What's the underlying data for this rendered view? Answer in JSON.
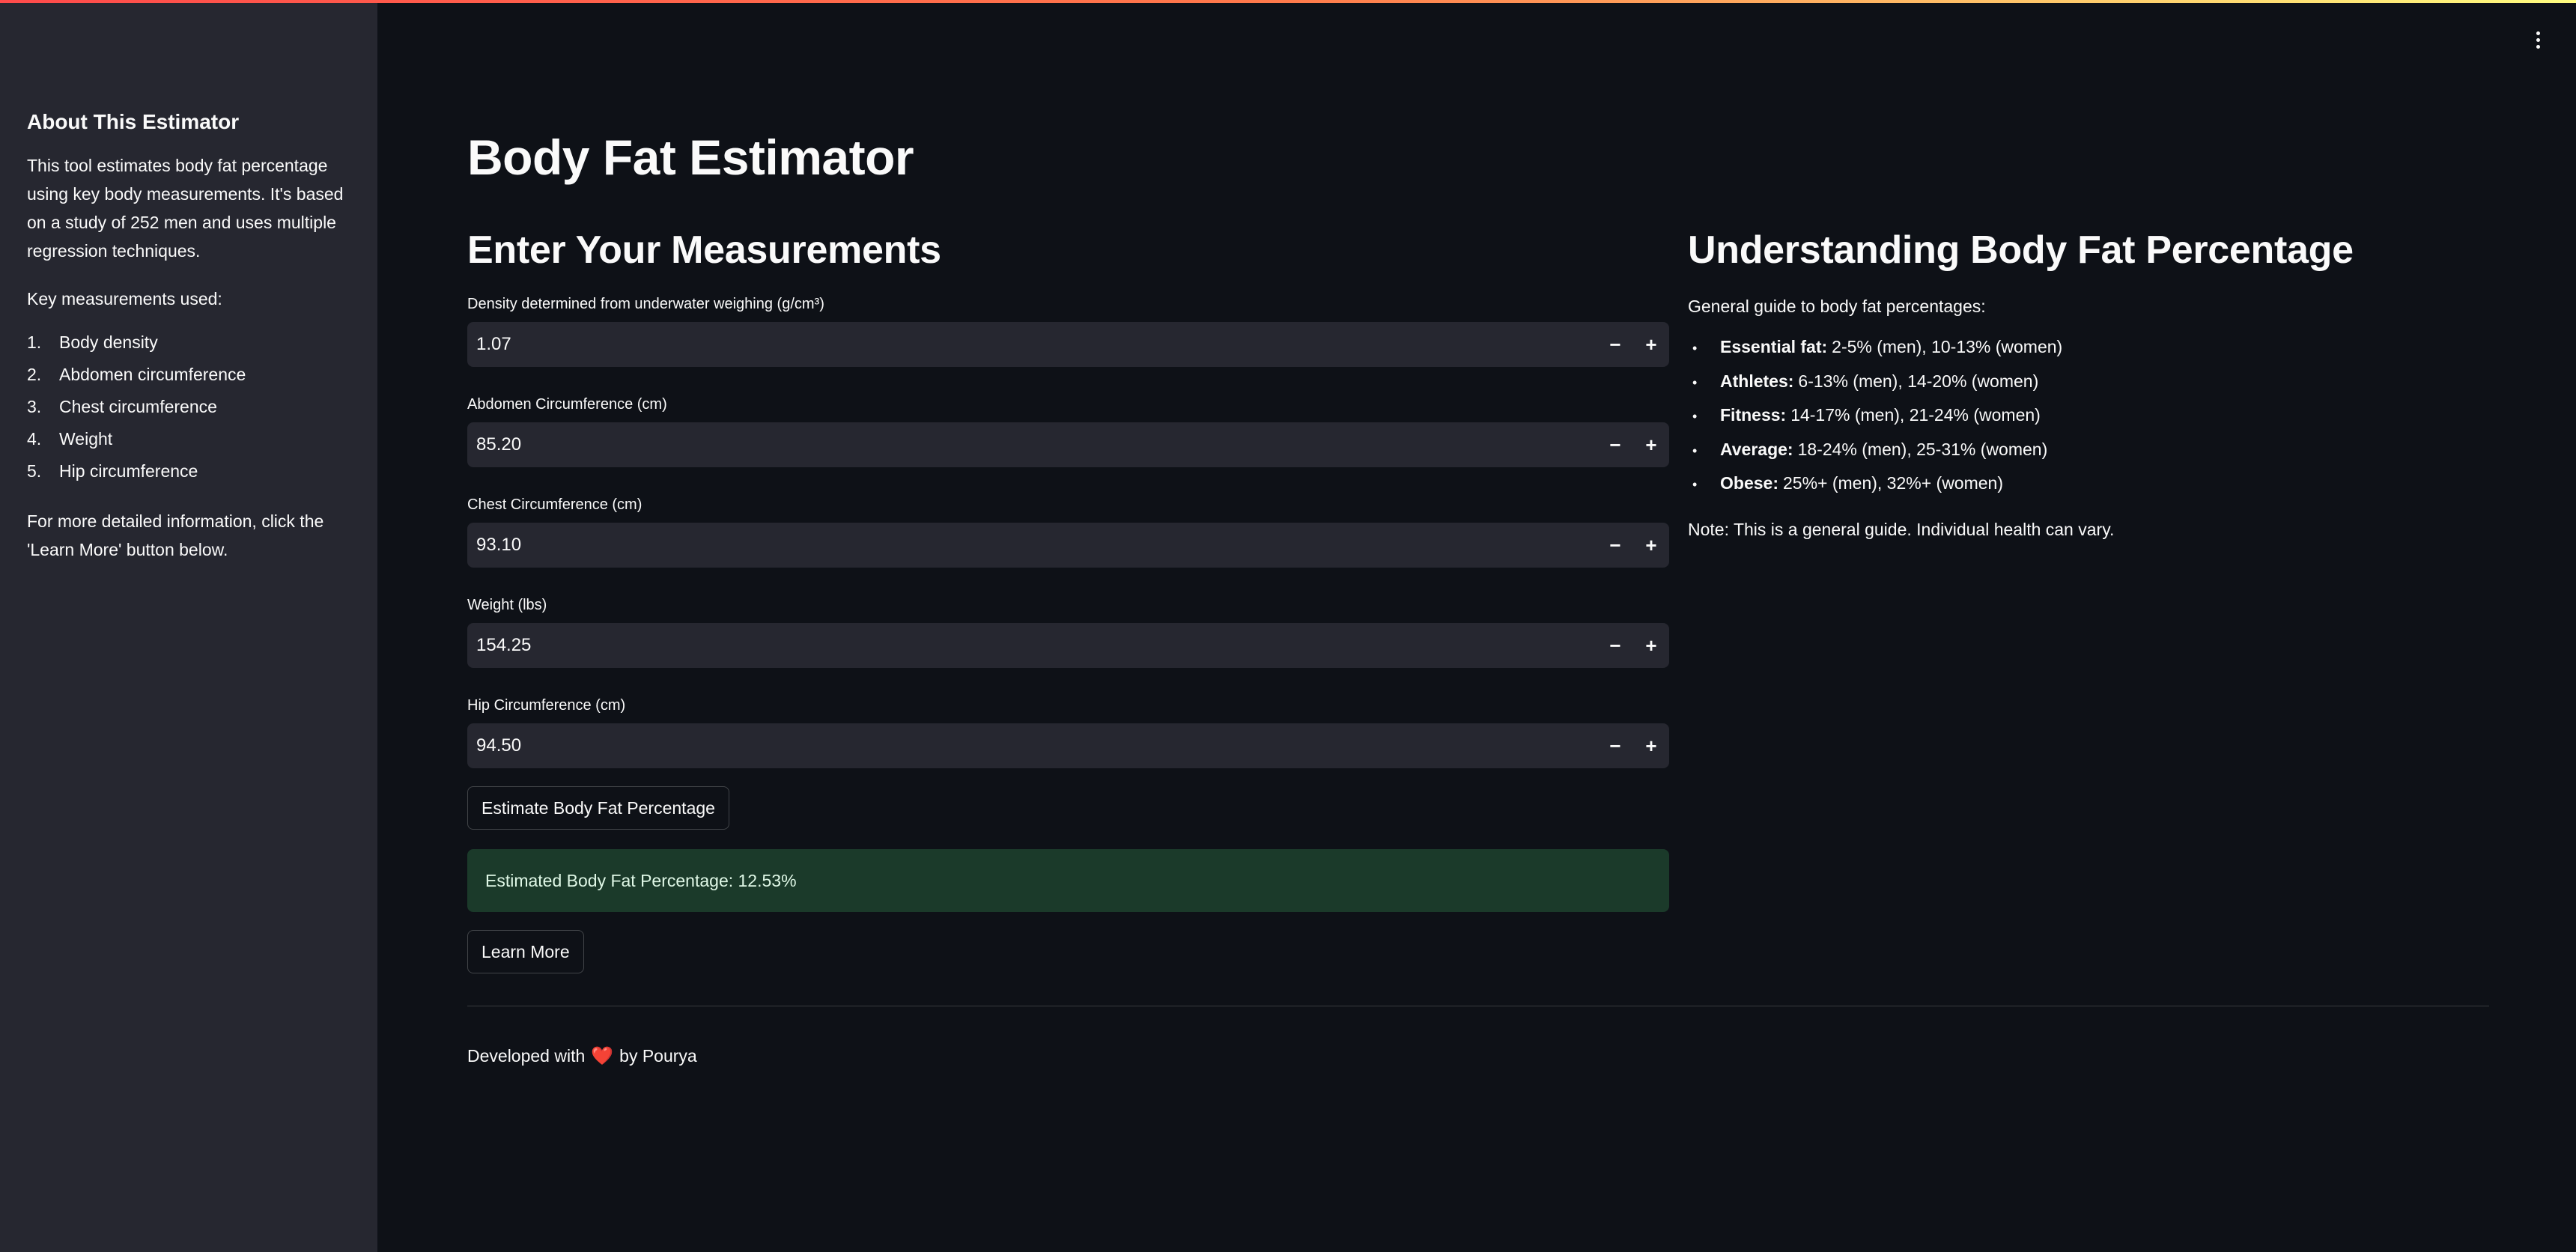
{
  "menu": {
    "icon": "vertical-ellipsis-icon"
  },
  "sidebar": {
    "title": "About This Estimator",
    "intro": "This tool estimates body fat percentage using key body measurements. It's based on a study of 252 men and uses multiple regression techniques.",
    "key_heading": "Key measurements used:",
    "items": [
      {
        "num": "1.",
        "label": "Body density"
      },
      {
        "num": "2.",
        "label": "Abdomen circumference"
      },
      {
        "num": "3.",
        "label": "Chest circumference"
      },
      {
        "num": "4.",
        "label": "Weight"
      },
      {
        "num": "5.",
        "label": "Hip circumference"
      }
    ],
    "outro": "For more detailed information, click the 'Learn More' button below."
  },
  "main": {
    "title": "Body Fat Estimator",
    "measurements_heading": "Enter Your Measurements",
    "fields": [
      {
        "label": "Density determined from underwater weighing (g/cm³)",
        "value": "1.07"
      },
      {
        "label": "Abdomen Circumference (cm)",
        "value": "85.20"
      },
      {
        "label": "Chest Circumference (cm)",
        "value": "93.10"
      },
      {
        "label": "Weight (lbs)",
        "value": "154.25"
      },
      {
        "label": "Hip Circumference (cm)",
        "value": "94.50"
      }
    ],
    "minus_label": "−",
    "plus_label": "+",
    "estimate_button": "Estimate Body Fat Percentage",
    "result": "Estimated Body Fat Percentage: 12.53%",
    "learn_more_button": "Learn More"
  },
  "guide": {
    "heading": "Understanding Body Fat Percentage",
    "intro": "General guide to body fat percentages:",
    "bullet": "•",
    "items": [
      {
        "term": "Essential fat:",
        "desc": "2-5% (men), 10-13% (women)"
      },
      {
        "term": "Athletes:",
        "desc": "6-13% (men), 14-20% (women)"
      },
      {
        "term": "Fitness:",
        "desc": "14-17% (men), 21-24% (women)"
      },
      {
        "term": "Average:",
        "desc": "18-24% (men), 25-31% (women)"
      },
      {
        "term": "Obese:",
        "desc": "25%+ (men), 32%+ (women)"
      }
    ],
    "note": "Note: This is a general guide. Individual health can vary."
  },
  "footer": {
    "prefix": "Developed with",
    "heart": "❤️",
    "suffix": "by Pourya"
  },
  "colors": {
    "background": "#0e1117",
    "sidebar": "#262730",
    "input": "#262730",
    "success": "#1b3a2a",
    "accent": "#ff4b4b"
  }
}
